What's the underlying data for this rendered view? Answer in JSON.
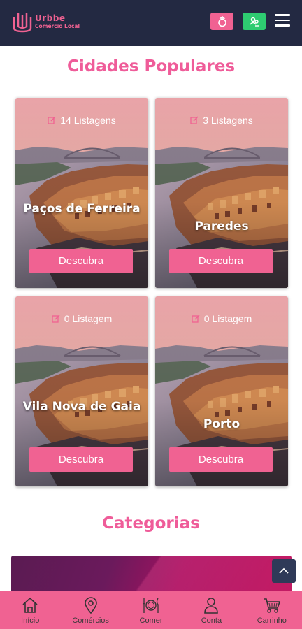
{
  "header": {
    "logo_title": "Urbbe",
    "logo_subtitle": "Comércio Local"
  },
  "sections": {
    "cities_title": "Cidades Populares",
    "categories_title": "Categorias"
  },
  "cities": [
    {
      "listings": "14 Listagens",
      "name": "Paços de Ferreira",
      "cta": "Descubra"
    },
    {
      "listings": "3 Listagens",
      "name": "Paredes",
      "cta": "Descubra"
    },
    {
      "listings": "0 Listagem",
      "name": "Vila Nova de Gaia",
      "cta": "Descubra"
    },
    {
      "listings": "0 Listagem",
      "name": "Porto",
      "cta": "Descubra"
    }
  ],
  "bottom_nav": [
    {
      "label": "Início",
      "icon": "home-icon"
    },
    {
      "label": "Comércios",
      "icon": "location-pin-icon"
    },
    {
      "label": "Comer",
      "icon": "plate-cutlery-icon"
    },
    {
      "label": "Conta",
      "icon": "user-icon"
    },
    {
      "label": "Carrinho",
      "icon": "cart-icon"
    }
  ],
  "colors": {
    "header_bg": "#232942",
    "accent_pink": "#f06292",
    "title_pink": "#ef5c99",
    "green": "#2ecc71"
  }
}
